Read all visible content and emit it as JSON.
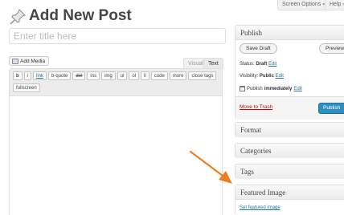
{
  "header": {
    "title": "Add New Post",
    "icon": "pushpin-icon",
    "screen_options_label": "Screen Options",
    "help_label": "Help"
  },
  "title_field": {
    "placeholder": "Enter title here",
    "value": ""
  },
  "editor": {
    "add_media_label": "Add Media",
    "tabs": [
      "Visual",
      "Text"
    ],
    "active_tab": "Text",
    "quicktags_row1": [
      "b",
      "i",
      "link",
      "b-quote",
      "del",
      "ins",
      "img",
      "ul",
      "ol",
      "li",
      "code",
      "more",
      "close tags"
    ],
    "quicktags_row2": [
      "fullscreen"
    ]
  },
  "publish_box": {
    "title": "Publish",
    "save_draft_label": "Save Draft",
    "preview_label": "Preview",
    "status_label": "Status:",
    "status_value": "Draft",
    "visibility_label": "Visibility:",
    "visibility_value": "Public",
    "publish_label": "Publish",
    "publish_when": "immediately",
    "edit_label": "Edit",
    "move_to_trash_label": "Move to Trash",
    "publish_button_label": "Publish"
  },
  "sidebar_boxes": {
    "format": "Format",
    "categories": "Categories",
    "tags": "Tags",
    "featured_image": "Featured Image",
    "set_featured_image_label": "Set featured image"
  },
  "colors": {
    "link": "#21759b",
    "trash": "#bc0b0b",
    "publish_button": "#2e8ec4",
    "arrow": "#f07d22"
  }
}
